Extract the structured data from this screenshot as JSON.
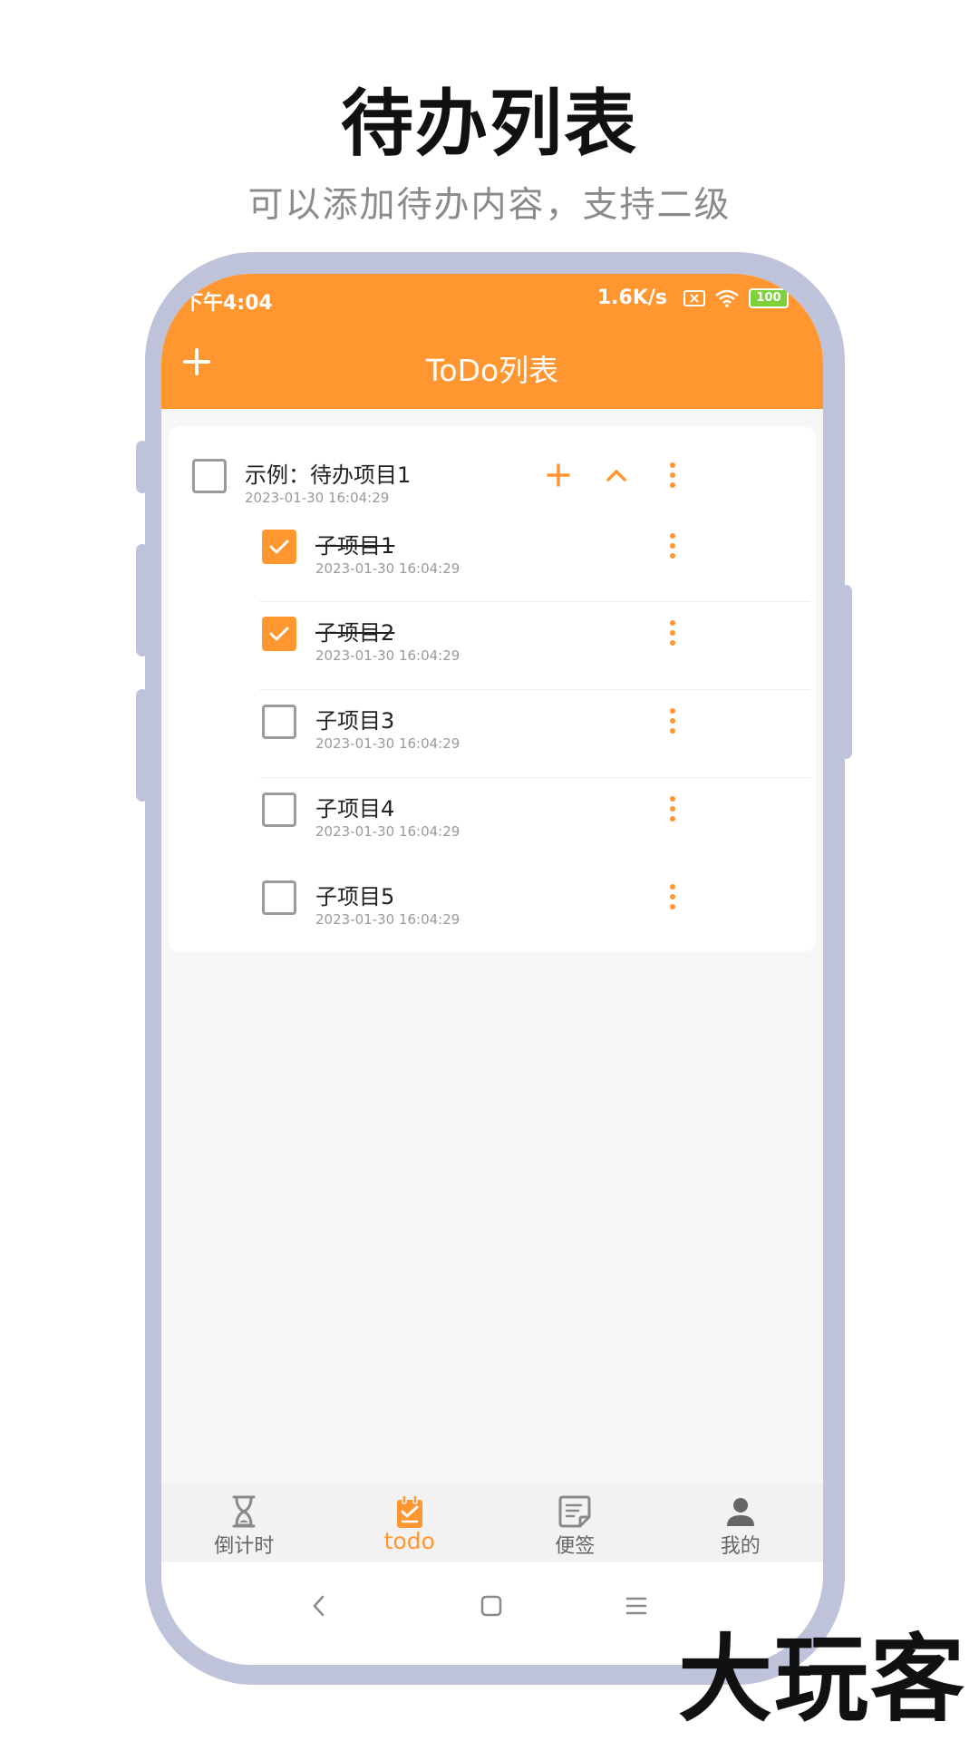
{
  "promo": {
    "title": "待办列表",
    "subtitle": "可以添加待办内容，支持二级"
  },
  "status_bar": {
    "time": "下午4:04",
    "network_speed": "1.6K/s",
    "battery": "100"
  },
  "header": {
    "title": "ToDo列表",
    "add_icon": "plus-icon"
  },
  "todo": {
    "parent": {
      "title": "示例：待办项目1",
      "time": "2023-01-30 16:04:29",
      "checked": false
    },
    "children": [
      {
        "title": "子项目1",
        "time": "2023-01-30 16:04:29",
        "checked": true
      },
      {
        "title": "子项目2",
        "time": "2023-01-30 16:04:29",
        "checked": true
      },
      {
        "title": "子项目3",
        "time": "2023-01-30 16:04:29",
        "checked": false
      },
      {
        "title": "子项目4",
        "time": "2023-01-30 16:04:29",
        "checked": false
      },
      {
        "title": "子项目5",
        "time": "2023-01-30 16:04:29",
        "checked": false
      }
    ]
  },
  "bottom_nav": {
    "items": [
      {
        "label": "倒计时",
        "icon": "hourglass-icon",
        "active": false
      },
      {
        "label": "todo",
        "icon": "clipboard-check-icon",
        "active": true
      },
      {
        "label": "便签",
        "icon": "note-icon",
        "active": false
      },
      {
        "label": "我的",
        "icon": "person-icon",
        "active": false
      }
    ]
  },
  "watermark": "大玩客",
  "colors": {
    "accent": "#ff9630",
    "phone_frame": "#bfc3da",
    "muted_text": "#9a9a9a"
  }
}
